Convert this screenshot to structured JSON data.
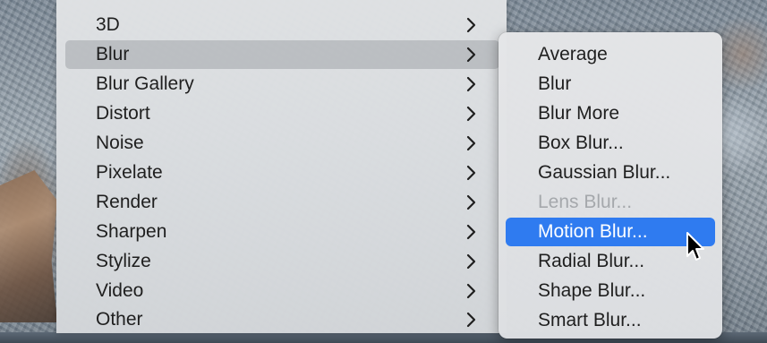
{
  "filter_menu": {
    "items": [
      {
        "label": "3D",
        "selected": false
      },
      {
        "label": "Blur",
        "selected": true
      },
      {
        "label": "Blur Gallery",
        "selected": false
      },
      {
        "label": "Distort",
        "selected": false
      },
      {
        "label": "Noise",
        "selected": false
      },
      {
        "label": "Pixelate",
        "selected": false
      },
      {
        "label": "Render",
        "selected": false
      },
      {
        "label": "Sharpen",
        "selected": false
      },
      {
        "label": "Stylize",
        "selected": false
      },
      {
        "label": "Video",
        "selected": false
      },
      {
        "label": "Other",
        "selected": false
      }
    ],
    "submenu_icon": "chevron-right-icon"
  },
  "blur_submenu": {
    "items": [
      {
        "label": "Average",
        "state": "normal"
      },
      {
        "label": "Blur",
        "state": "normal"
      },
      {
        "label": "Blur More",
        "state": "normal"
      },
      {
        "label": "Box Blur...",
        "state": "normal"
      },
      {
        "label": "Gaussian Blur...",
        "state": "normal"
      },
      {
        "label": "Lens Blur...",
        "state": "disabled"
      },
      {
        "label": "Motion Blur...",
        "state": "highlighted"
      },
      {
        "label": "Radial Blur...",
        "state": "normal"
      },
      {
        "label": "Shape Blur...",
        "state": "normal"
      },
      {
        "label": "Smart Blur...",
        "state": "normal"
      }
    ]
  },
  "colors": {
    "highlight": "#2f7bf0",
    "text": "#1f1f1f",
    "disabled_text": "#a5a8ac"
  },
  "cursor": "arrow-pointer-icon"
}
